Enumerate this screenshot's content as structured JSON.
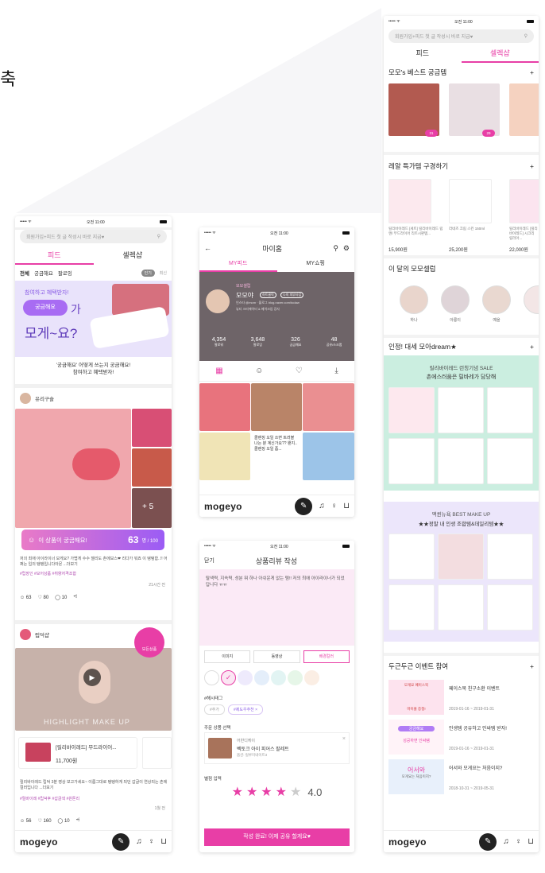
{
  "page": {
    "lede_char": "축"
  },
  "status": {
    "time": "오전 11:00",
    "signal": "••••• ᯤ"
  },
  "search": {
    "placeholder": "회원가입+피드 첫 글 작성시 바로 지급♥"
  },
  "feed": {
    "tabs": [
      "피드",
      "셀렉샵"
    ],
    "filters": [
      "전체",
      "궁금해요",
      "팔로잉"
    ],
    "sorts": [
      "인기",
      "최신"
    ],
    "banner": {
      "line1": "참여하고 혜택받자!",
      "chip": "궁금해요",
      "suffix": "가",
      "line2": "모게~요?"
    },
    "caption": {
      "l1": "'궁금해요' 어떻게 쓰는지 궁금해요!",
      "l2": "참여하고 혜택받자!"
    },
    "post1": {
      "user": "유리구슬",
      "more": "+ 5",
      "want_label": "이 상품이 궁금해요!",
      "want_count": "63",
      "want_unit": "명 / 100",
      "text": "저의 최애 아이라이너 모게요? 가볍게 수수 젤리도 촌에보스❤ 리다가 뭐죠 이 탱탱함..!! 어쩌는 입의 탱탱입니다아몬 ...더보기",
      "tags": "#립장인 #모어상품 #취향저격조합",
      "time": "21시간 전",
      "stats": {
        "smile": "63",
        "heart": "80",
        "comment": "10"
      }
    },
    "post2": {
      "user": "립덕샵",
      "fab": "모든상품",
      "overlay": "HIGHLIGHT MAKE UP",
      "product": "[릴리바이레드] 무드라이어...",
      "price": "11,700원",
      "text": "릴리바이레드 립덕 3분 영상 보고가세요~ 이름그대로 탱탱하게 되던 갑글이 연상되는 촌에컬러입니다 ...더보기",
      "tags": "#릴바이레 #립덕후 #갑글색 #원톤리",
      "time": "1월 전",
      "stats": {
        "smile": "56",
        "heart": "160",
        "comment": "10"
      }
    },
    "nav": {
      "logo": "mogeyo"
    }
  },
  "myhome": {
    "title": "마이홈",
    "tabs": [
      "MY피드",
      "MY쇼핑"
    ],
    "badge": "모모셀럽",
    "name": "모모야",
    "chip1": "하트클릭",
    "chip2": "나의 피부타입",
    "bio1": "인스타 @mom · 블로그 blog.naver.com/todaw",
    "bio2": "뷰티 크리에이터 & 메이크업 강사",
    "stats": [
      {
        "n": "4,354",
        "l": "팔로워"
      },
      {
        "n": "3,648",
        "l": "팔로잉"
      },
      {
        "n": "326",
        "l": "궁금해요"
      },
      {
        "n": "48",
        "l": "공유/스크랩"
      }
    ],
    "tile_text": "클렌징 오일 쓰면 트러블 나는 분 계신가요?? 왠지.. 클렌징 오일 좀..."
  },
  "review": {
    "close": "닫기",
    "title": "상품리뷰 작성",
    "body": "탈색력, 지속력, 성분 뭐 하나 아쉬운게 없는 템!! 저의 최애 아이라이너가 되었답니다 ㅠㅠ",
    "media": [
      "이미지",
      "동영상",
      "배경컬러"
    ],
    "hashtag_label": "#해시태그",
    "hashtags": [
      "#추가",
      "#제도우추천"
    ],
    "product_label": "주문 상품 선택",
    "brand": "어반디케이",
    "product_name": "벡토크 아이 피어스 팔레트",
    "product_opt": "옵션: 릴루미네이트3",
    "rating_label": "별점 입력",
    "rating": "4.0",
    "rating_value": 4,
    "submit": "작성 완료! 이제 공유 할게요♥"
  },
  "select": {
    "tabs": [
      "피드",
      "셀렉샵"
    ],
    "best_title": "모모's 베스트 궁금템",
    "best_badges": [
      "31",
      "29"
    ],
    "deal_title": "레알 특가템 구경하기",
    "deals": [
      {
        "t": "릴리바이레드 [세트] 릴리바이레드 립앤/ 무드라이어 리트시판템...",
        "p": "15,900원"
      },
      {
        "t": "라네즈 크림 스킨 150ml",
        "p": "25,200원"
      },
      {
        "t": "릴리바이레드 [릴리바이레드] 시크리 릴리아...",
        "p": "22,000원"
      }
    ],
    "celeb_title": "이 달의 모모셀럽",
    "celebs": [
      "하나",
      "아롱이",
      "예을"
    ],
    "dream_title": "인정! 대세 모아dream★",
    "dream_l1": "릴리바이레드 런칭기념 SALE",
    "dream_l2": "촌에스러움은 릴바레가 담당해",
    "best_l1": "맥퀸뉴욕 BEST MAKE UP",
    "best_l2": "★★정말 내 인생 조합템&데일리템★★",
    "event_title": "두근두근 이벤트 참여",
    "events": [
      {
        "t": "페이스북 친구소환 이벤트",
        "d": "2019-01-16 ~ 2019-01-31",
        "thumb": "모게요 페이스북",
        "thumb2": "마이풀 증정!"
      },
      {
        "t": "인생템 공유하고 인싸템 받자!",
        "d": "2019-01-16 ~ 2019-01-31",
        "thumb": "궁금해요",
        "thumb2": "성공하면 인싸템"
      },
      {
        "t": "어서와 모게요는 처음이지?",
        "d": "2018-10-31 ~ 2019-05-31",
        "thumb": "어서와",
        "thumb2": "모게요는 처음이지?"
      }
    ],
    "plus": "+"
  },
  "colors": {
    "accent": "#e83ea6",
    "purple": "#9b5cf5",
    "mint": "#cbeee0",
    "lilac": "#ece6fb"
  },
  "icons": [
    "search-icon",
    "back-icon",
    "gear-icon",
    "grid-icon",
    "smile-icon",
    "heart-icon",
    "comment-icon",
    "share-icon",
    "pen-icon",
    "bell-icon",
    "person-icon",
    "bag-icon",
    "download-icon",
    "play-icon",
    "plus-icon",
    "star-icon"
  ]
}
